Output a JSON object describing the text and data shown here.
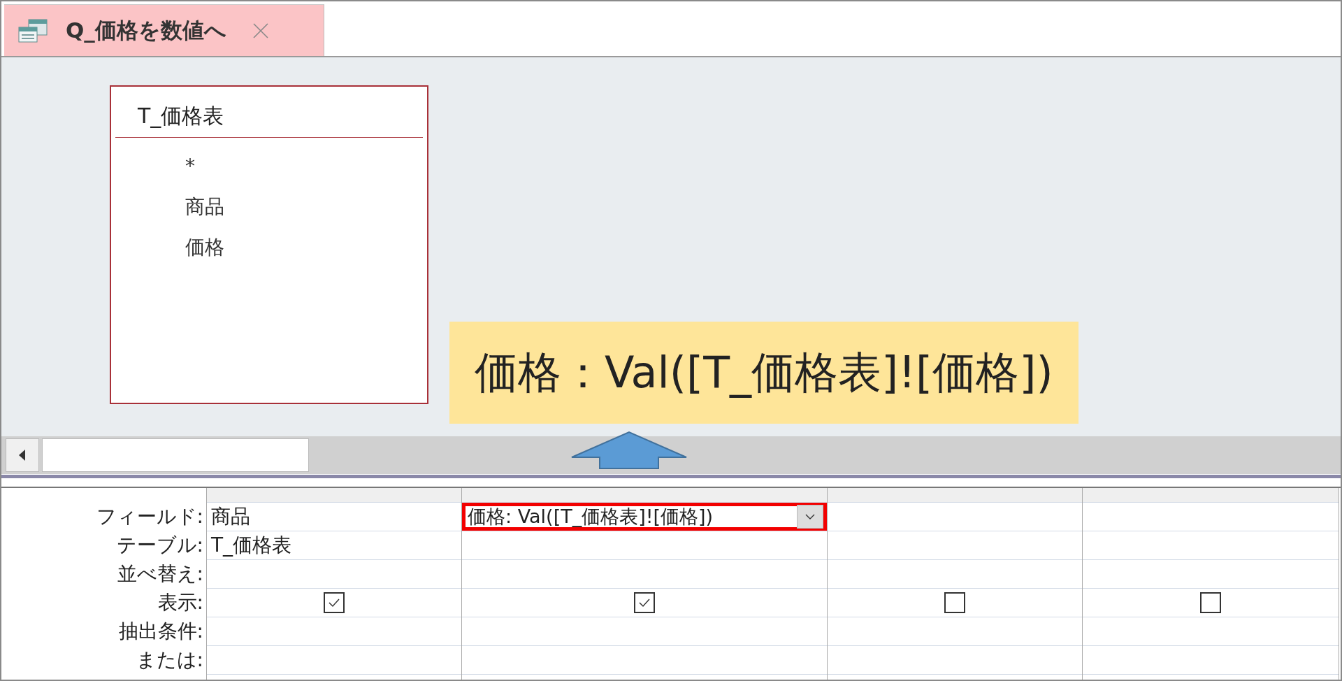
{
  "tab": {
    "title": "Q_価格を数値へ",
    "selected": true
  },
  "table_box": {
    "title": "T_価格表",
    "fields": [
      "*",
      "商品",
      "価格"
    ]
  },
  "callout": {
    "text": "価格：Val([T_価格表]![価格])"
  },
  "grid": {
    "row_labels": [
      "フィールド:",
      "テーブル:",
      "並べ替え:",
      "表示:",
      "抽出条件:",
      "または:"
    ],
    "columns": [
      {
        "field": "商品",
        "table": "T_価格表",
        "show": true,
        "highlighted": false
      },
      {
        "field": "価格: Val([T_価格表]![価格])",
        "show": true,
        "highlighted": true
      },
      {
        "show": false,
        "highlighted": false
      },
      {
        "show": false,
        "highlighted": false
      }
    ]
  }
}
